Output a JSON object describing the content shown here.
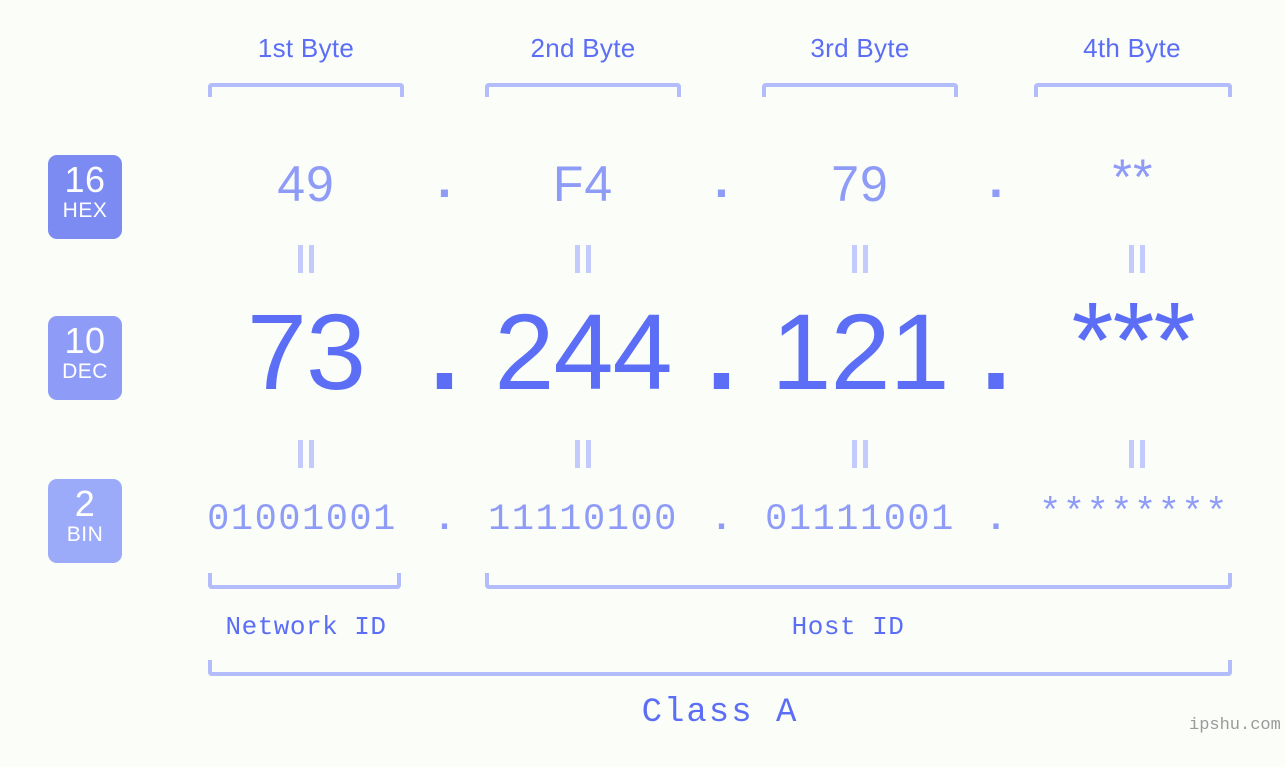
{
  "meta": {
    "background_color": "#fbfdf9",
    "accent_strong": "#5b6ef5",
    "accent_light": "#8e9cf7",
    "accent_pale": "#b3bdfb"
  },
  "byte_headers": [
    {
      "label": "1st Byte"
    },
    {
      "label": "2nd Byte"
    },
    {
      "label": "3rd Byte"
    },
    {
      "label": "4th Byte"
    }
  ],
  "bases": [
    {
      "number": "16",
      "abbr": "HEX",
      "color": "#7b8bf2"
    },
    {
      "number": "10",
      "abbr": "DEC",
      "color": "#8e9cf7"
    },
    {
      "number": "2",
      "abbr": "BIN",
      "color": "#9babfa"
    }
  ],
  "rows": {
    "hex": {
      "base_number": "16",
      "base_abbr": "HEX",
      "values": [
        "49",
        "F4",
        "79",
        "**"
      ],
      "separator": "."
    },
    "dec": {
      "base_number": "10",
      "base_abbr": "DEC",
      "values": [
        "73",
        "244",
        "121",
        "***"
      ],
      "separator": "."
    },
    "bin": {
      "base_number": "2",
      "base_abbr": "BIN",
      "values": [
        "01001001",
        "11110100",
        "01111001",
        "********"
      ],
      "separator": "."
    }
  },
  "segments": {
    "network_id": "Network ID",
    "host_id": "Host ID",
    "ip_class": "Class A"
  },
  "watermark": "ipshu.com"
}
